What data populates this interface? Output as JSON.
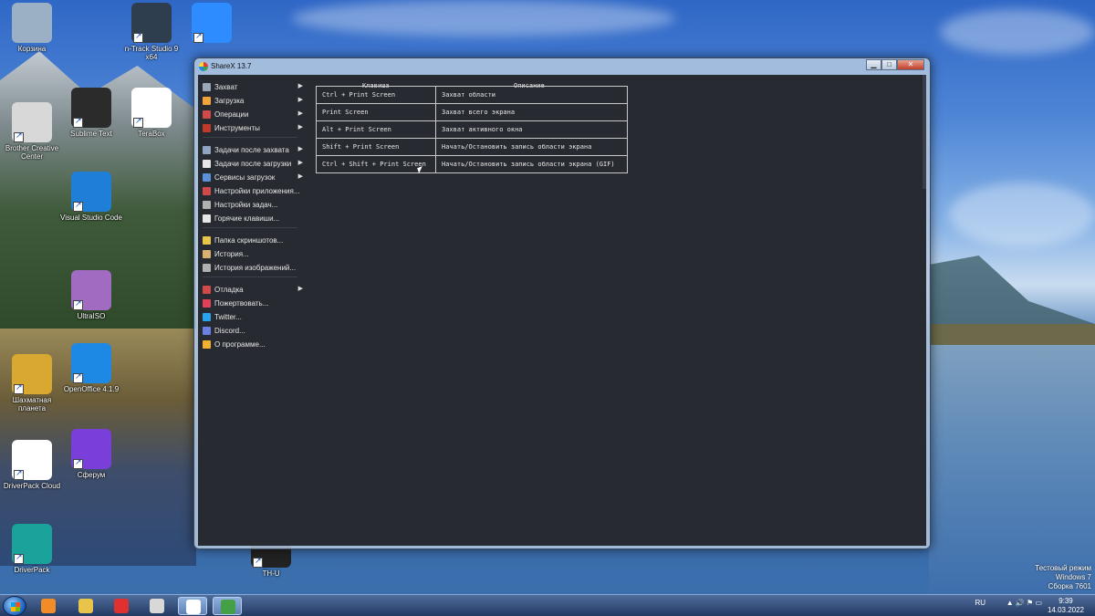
{
  "desktop": {
    "icons": [
      {
        "label": "Корзина",
        "icon": "recycle-bin-icon",
        "color": "#9bb0c4"
      },
      {
        "label": "n-Track Studio 9 x64",
        "icon": "ntrack-icon",
        "color": "#2f3e4f"
      },
      {
        "label": "",
        "icon": "zoom-icon",
        "color": "#2d8cff"
      },
      {
        "label": "Brother Creative Center",
        "icon": "brother-icon",
        "color": "#d8d8d8"
      },
      {
        "label": "Sublime Text",
        "icon": "sublime-icon",
        "color": "#2b2b2b"
      },
      {
        "label": "TeraBox",
        "icon": "terabox-icon",
        "color": "#ffffff"
      },
      {
        "label": "Visual Studio Code",
        "icon": "vscode-icon",
        "color": "#1f7fd8"
      },
      {
        "label": "UltraISO",
        "icon": "ultraiso-icon",
        "color": "#a06bc0"
      },
      {
        "label": "Шахматная планета",
        "icon": "chess-icon",
        "color": "#d8a830"
      },
      {
        "label": "OpenOffice 4.1.9",
        "icon": "openoffice-icon",
        "color": "#1e88e5"
      },
      {
        "label": "DriverPack Cloud",
        "icon": "7z-icon",
        "color": "#ffffff"
      },
      {
        "label": "Сферум",
        "icon": "sferum-icon",
        "color": "#7a3fd8"
      },
      {
        "label": "DriverPack",
        "icon": "driverpack-icon",
        "color": "#1aa39a"
      },
      {
        "label": "TH-U",
        "icon": "thu-icon",
        "color": "#222222"
      }
    ],
    "watermark": {
      "line1": "Тестовый режим",
      "line2": "Windows 7",
      "line3": "Сборка 7601"
    }
  },
  "window": {
    "title": "ShareX 13.7",
    "controls": {
      "minimize": "▁",
      "maximize": "□",
      "close": "✕"
    },
    "menu": [
      {
        "label": "Захват",
        "icon": "capture-icon",
        "color": "#9aa7b6",
        "submenu": true
      },
      {
        "label": "Загрузка",
        "icon": "upload-icon",
        "color": "#f2a33a",
        "submenu": true
      },
      {
        "label": "Операции",
        "icon": "workflow-icon",
        "color": "#d04a4a",
        "submenu": true
      },
      {
        "label": "Инструменты",
        "icon": "tools-icon",
        "color": "#c0392b",
        "submenu": true
      },
      {
        "label": "Задачи после захвата",
        "icon": "after-capture-icon",
        "color": "#8fa4c0",
        "submenu": true
      },
      {
        "label": "Задачи после загрузки",
        "icon": "after-upload-icon",
        "color": "#e6e6e6",
        "submenu": true
      },
      {
        "label": "Сервисы загрузок",
        "icon": "destinations-icon",
        "color": "#5b8fd6",
        "submenu": true
      },
      {
        "label": "Настройки приложения...",
        "icon": "app-settings-icon",
        "color": "#d04a4a",
        "submenu": false
      },
      {
        "label": "Настройки задач...",
        "icon": "task-settings-icon",
        "color": "#b0b0b0",
        "submenu": false
      },
      {
        "label": "Горячие клавиши...",
        "icon": "hotkeys-icon",
        "color": "#e6e6e6",
        "submenu": false
      },
      {
        "label": "Папка скриншотов...",
        "icon": "folder-icon",
        "color": "#e8c44a",
        "submenu": false
      },
      {
        "label": "История...",
        "icon": "history-icon",
        "color": "#d8b070",
        "submenu": false
      },
      {
        "label": "История изображений...",
        "icon": "image-history-icon",
        "color": "#b0b0b0",
        "submenu": false
      },
      {
        "label": "Отладка",
        "icon": "debug-icon",
        "color": "#d04a4a",
        "submenu": true
      },
      {
        "label": "Пожертвовать...",
        "icon": "heart-icon",
        "color": "#e0405a",
        "submenu": false
      },
      {
        "label": "Twitter...",
        "icon": "twitter-icon",
        "color": "#2aa3ef",
        "submenu": false
      },
      {
        "label": "Discord...",
        "icon": "discord-icon",
        "color": "#6a7fe0",
        "submenu": false
      },
      {
        "label": "О программе...",
        "icon": "about-icon",
        "color": "#f0b030",
        "submenu": false
      }
    ],
    "hotkeys": {
      "col_key": "Клавиша",
      "col_desc": "Описание",
      "rows": [
        {
          "key": "Ctrl + Print Screen",
          "desc": "Захват области"
        },
        {
          "key": "Print Screen",
          "desc": "Захват всего экрана"
        },
        {
          "key": "Alt + Print Screen",
          "desc": "Захват активного окна"
        },
        {
          "key": "Shift + Print Screen",
          "desc": "Начать/Остановить запись области экрана"
        },
        {
          "key": "Ctrl + Shift + Print Screen",
          "desc": "Начать/Остановить запись области экрана (GIF)"
        }
      ]
    }
  },
  "taskbar": {
    "items": [
      {
        "icon": "media-player-icon",
        "color": "#f28c28"
      },
      {
        "icon": "explorer-icon",
        "color": "#e8c44a"
      },
      {
        "icon": "yandex-icon",
        "color": "#e03030"
      },
      {
        "icon": "app-icon",
        "color": "#d8d8d8"
      },
      {
        "icon": "yandex-browser-icon",
        "color": "#ffffff"
      },
      {
        "icon": "sharex-icon",
        "color": "#43a047"
      }
    ],
    "lang": "RU",
    "time": "9:39",
    "date": "14.03.2022"
  }
}
